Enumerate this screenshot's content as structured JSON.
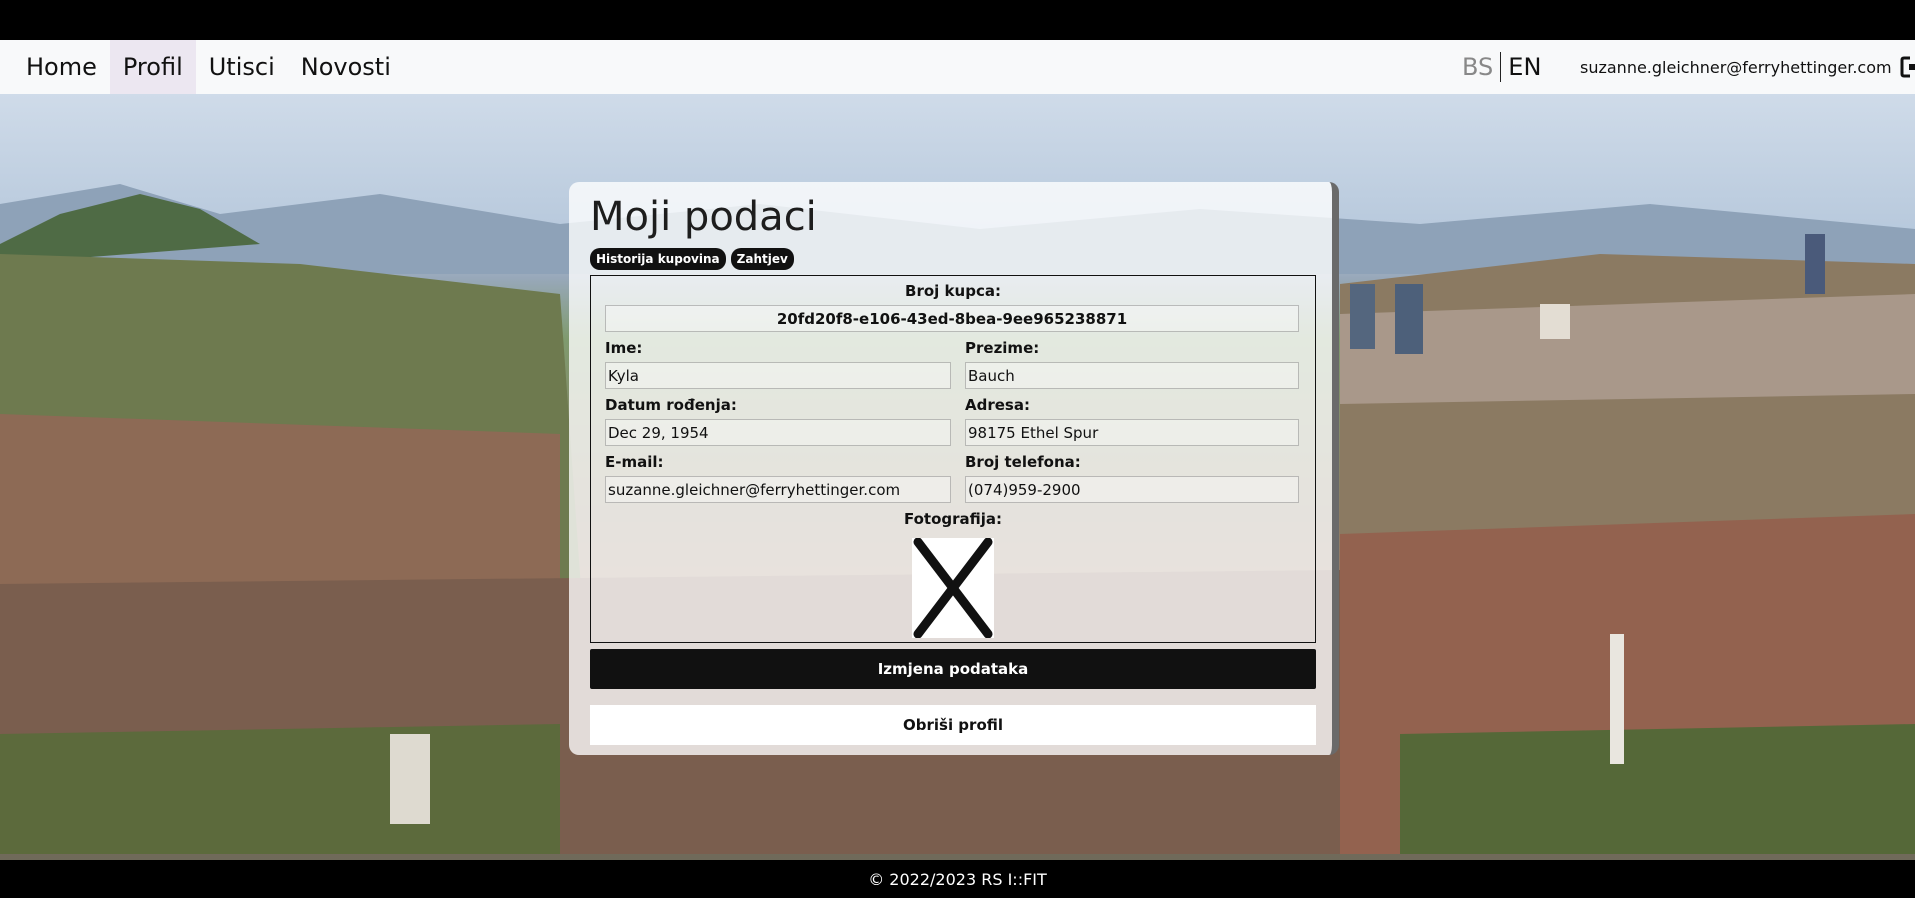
{
  "nav": {
    "links": [
      "Home",
      "Profil",
      "Utisci",
      "Novosti"
    ],
    "active": "Profil"
  },
  "lang": {
    "bs": "BS",
    "en": "EN",
    "active": "EN"
  },
  "user": {
    "email": "suzanne.gleichner@ferryhettinger.com",
    "logout_icon": "sign-out-icon"
  },
  "profile": {
    "title": "Moji podaci",
    "buttons": {
      "history": "Historija kupovina",
      "request": "Zahtjev"
    },
    "customer_number_label": "Broj kupca:",
    "customer_number": "20fd20f8-e106-43ed-8bea-9ee965238871",
    "first_name_label": "Ime:",
    "first_name": "Kyla",
    "last_name_label": "Prezime:",
    "last_name": "Bauch",
    "dob_label": "Datum rođenja:",
    "dob": "Dec 29, 1954",
    "address_label": "Adresa:",
    "address": "98175 Ethel Spur",
    "email_label": "E-mail:",
    "email": "suzanne.gleichner@ferryhettinger.com",
    "phone_label": "Broj telefona:",
    "phone": "(074)959-2900",
    "photo_label": "Fotografija:",
    "photo_icon": "placeholder-x-icon",
    "edit_button": "Izmjena podataka",
    "delete_button": "Obriši profil"
  },
  "footer": {
    "text": "© 2022/2023 RS I::FIT"
  },
  "colors": {
    "dark_button": "#111111",
    "nav_bg": "#f8f9fa",
    "active_tab": "#ece7f1"
  }
}
